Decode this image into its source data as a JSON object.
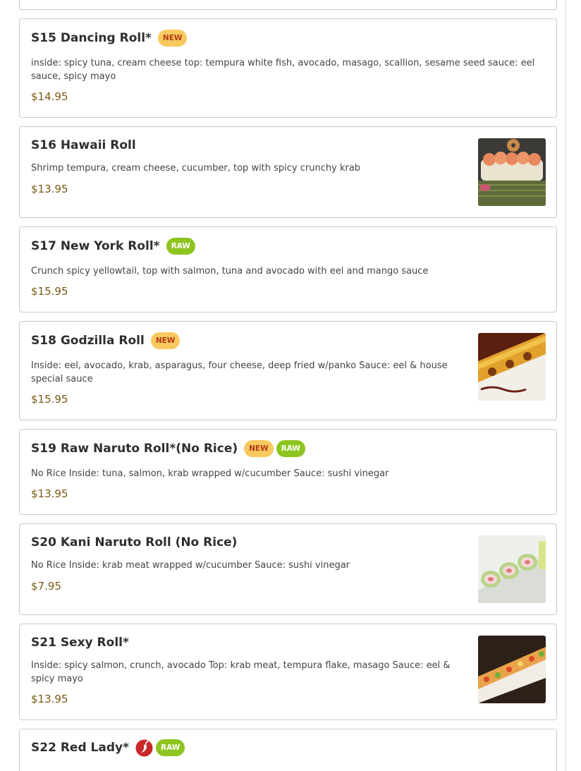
{
  "items": [
    {
      "title": "S15 Dancing Roll*",
      "badges": [
        "NEW"
      ],
      "description": "inside: spicy tuna, cream cheese top: tempura white fish, avocado, masago, scallion, sesame seed sauce: eel sauce, spicy mayo",
      "price": "$14.95"
    },
    {
      "title": "S16 Hawaii Roll",
      "badges": [],
      "description": "Shrimp tempura, cream cheese, cucumber, top with spicy crunchy krab",
      "price": "$13.95",
      "image": "hawaii-roll-photo"
    },
    {
      "title": "S17 New York Roll*",
      "badges": [
        "RAW"
      ],
      "description": "Crunch spicy yellowtail, top with salmon, tuna and avocado with eel and mango sauce",
      "price": "$15.95"
    },
    {
      "title": "S18 Godzilla Roll",
      "badges": [
        "NEW"
      ],
      "description": "Inside: eel, avocado, krab, asparagus, four cheese, deep fried w/panko Sauce: eel & house special sauce",
      "price": "$15.95",
      "image": "godzilla-roll-photo"
    },
    {
      "title": "S19 Raw Naruto Roll*(No Rice)",
      "badges": [
        "NEW",
        "RAW"
      ],
      "description": "No Rice Inside: tuna, salmon, krab wrapped w/cucumber Sauce: sushi vinegar",
      "price": "$13.95"
    },
    {
      "title": "S20 Kani Naruto Roll (No Rice)",
      "badges": [],
      "description": "No Rice Inside: krab meat wrapped w/cucumber Sauce: sushi vinegar",
      "price": "$7.95",
      "image": "kani-naruto-roll-photo"
    },
    {
      "title": "S21 Sexy Roll*",
      "badges": [],
      "description": "Inside: spicy salmon, crunch, avocado Top: krab meat, tempura flake, masago Sauce: eel & spicy mayo",
      "price": "$13.95",
      "image": "sexy-roll-photo"
    },
    {
      "title": "S22 Red Lady*",
      "badges": [
        "RAW"
      ],
      "spicy_icon": "chili-pepper-icon",
      "description": "",
      "price": ""
    }
  ],
  "colors": {
    "new_badge_bg": "#f7c95f",
    "new_badge_text": "#b23a14",
    "raw_badge_bg": "#8dc41f",
    "price": "#7a5a12",
    "spicy_icon": "#c8282a"
  }
}
